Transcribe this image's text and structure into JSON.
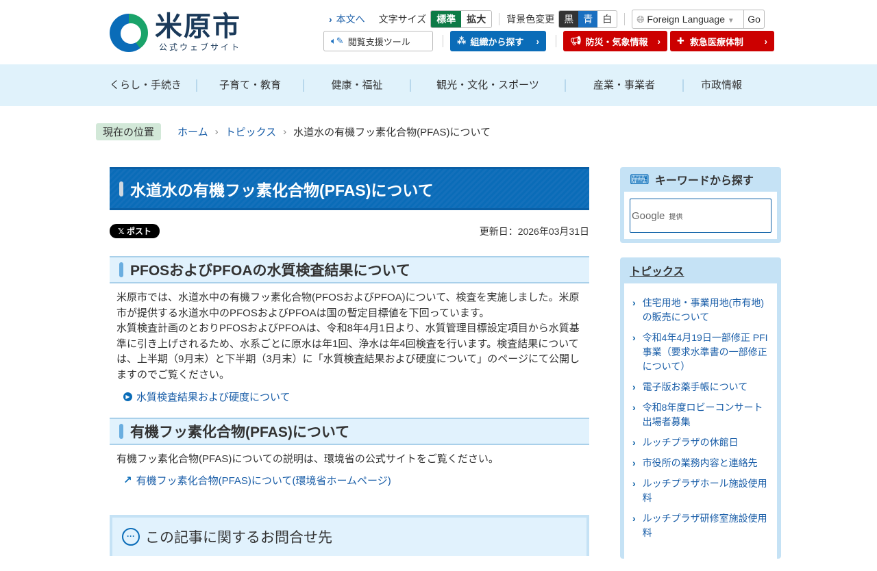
{
  "header": {
    "logo_title": "米原市",
    "logo_sub": "公式ウェブサイト",
    "skip_link": "本文へ",
    "font_size_label": "文字サイズ",
    "font_sizes": [
      "標準",
      "拡大"
    ],
    "bg_color_label": "背景色変更",
    "bg_colors": [
      "黒",
      "青",
      "白"
    ],
    "language_select": "Foreign Language",
    "go": "Go",
    "reading_tool": "閲覧支援ツール",
    "org_search": "組織から探す",
    "disaster": "防災・気象情報",
    "emergency": "救急医療体制"
  },
  "nav": [
    "くらし・手続き",
    "子育て・教育",
    "健康・福祉",
    "観光・文化・スポーツ",
    "産業・事業者",
    "市政情報"
  ],
  "breadcrumb": {
    "label": "現在の位置",
    "items": [
      "ホーム",
      "トピックス",
      "水道水の有機フッ素化合物(PFAS)について"
    ]
  },
  "main": {
    "title": "水道水の有機フッ素化合物(PFAS)について",
    "post_button": "ポスト",
    "updated": "更新日：2026年03月31日",
    "section1": {
      "heading": "PFOSおよびPFOAの水質検査結果について",
      "para1": "米原市では、水道水中の有機フッ素化合物(PFOSおよびPFOA)について、検査を実施しました。米原市が提供する水道水中のPFOSおよびPFOAは国の暫定目標値を下回っています。",
      "para2": "水質検査計画のとおりPFOSおよびPFOAは、令和8年4月1日より、水質管理目標設定項目から水質基準に引き上げされるため、水系ごとに原水は年1回、浄水は年4回検査を行います。検査結果については、上半期（9月末）と下半期（3月末）に「水質検査結果および硬度について」のページにて公開しますのでご覧ください。",
      "link": "水質検査結果および硬度について"
    },
    "section2": {
      "heading": "有機フッ素化合物(PFAS)について",
      "para": "有機フッ素化合物(PFAS)についての説明は、環境省の公式サイトをご覧ください。",
      "link": "有機フッ素化合物(PFAS)について(環境省ホームページ)"
    },
    "contact_heading": "この記事に関するお問合せ先"
  },
  "sidebar": {
    "keyword_heading": "キーワードから探す",
    "google": "Google",
    "google_sub": "提供",
    "topics_heading": "トピックス",
    "topics": [
      "住宅用地・事業用地(市有地)の販売について",
      "令和4年4月19日一部修正 PFI事業（要求水準書の一部修正について）",
      "電子版お薬手帳について",
      "令和8年度ロビーコンサート出場者募集",
      "ルッチプラザの休館日",
      "市役所の業務内容と連絡先",
      "ルッチプラザホール施設使用料",
      "ルッチプラザ研修室施設使用料"
    ]
  }
}
